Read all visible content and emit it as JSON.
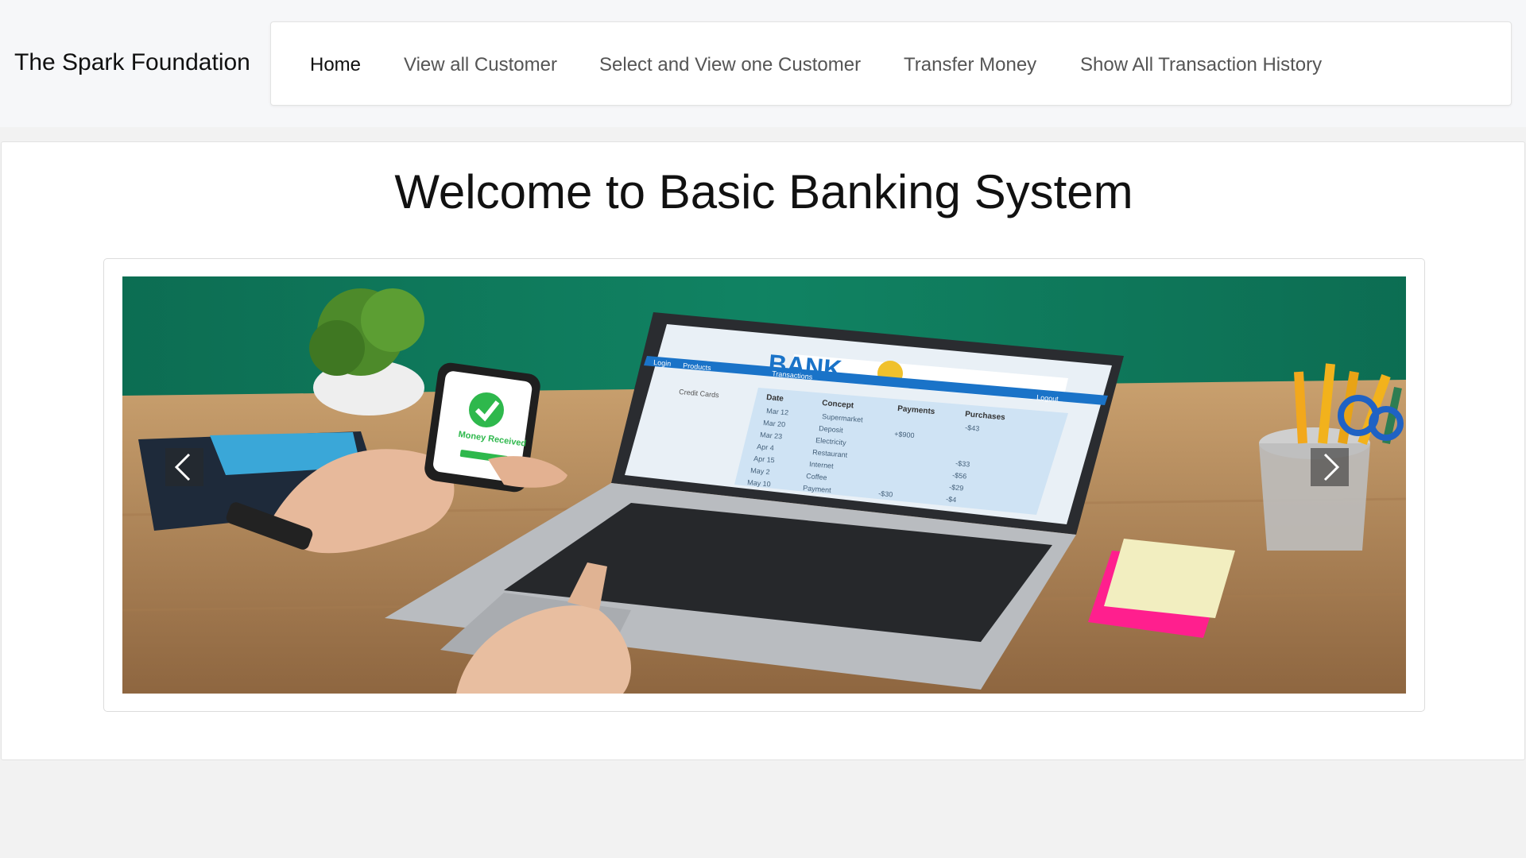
{
  "brand": "The Spark Foundation",
  "nav": {
    "items": [
      {
        "label": "Home",
        "active": true
      },
      {
        "label": "View all Customer",
        "active": false
      },
      {
        "label": "Select and View one Customer",
        "active": false
      },
      {
        "label": "Transfer Money",
        "active": false
      },
      {
        "label": "Show All Transaction History",
        "active": false
      }
    ]
  },
  "main": {
    "title": "Welcome to Basic Banking System"
  },
  "carousel": {
    "prev_icon": "chevron-left-icon",
    "next_icon": "chevron-right-icon",
    "slide": {
      "bank_logo": "BANK",
      "phone_status": "Money Received",
      "screen_menu": [
        "Login",
        "Products",
        "Transactions",
        "Logout"
      ],
      "table_headers": [
        "Date",
        "Concept",
        "Payments",
        "Purchases"
      ],
      "sidebar_item": "Credit Cards",
      "table_rows": [
        {
          "date": "Mar 12",
          "concept": "Supermarket",
          "payment": "",
          "purchase": "-$43"
        },
        {
          "date": "Mar 20",
          "concept": "Deposit",
          "payment": "+$900",
          "purchase": ""
        },
        {
          "date": "Mar 23",
          "concept": "Electricity",
          "payment": "",
          "purchase": ""
        },
        {
          "date": "Apr 4",
          "concept": "Restaurant",
          "payment": "",
          "purchase": "-$33"
        },
        {
          "date": "Apr 15",
          "concept": "Internet",
          "payment": "",
          "purchase": "-$56"
        },
        {
          "date": "May 2",
          "concept": "Coffee",
          "payment": "",
          "purchase": "-$29"
        },
        {
          "date": "May 10",
          "concept": "Payment",
          "payment": "-$30",
          "purchase": "-$4"
        }
      ]
    }
  },
  "colors": {
    "page_bg": "#f2f2f2",
    "topbar_bg": "#f6f7f9",
    "wall": "#0e7a5c",
    "desk": "#b8895a",
    "check_green": "#2eb84c",
    "bank_blue": "#1a73c8"
  }
}
